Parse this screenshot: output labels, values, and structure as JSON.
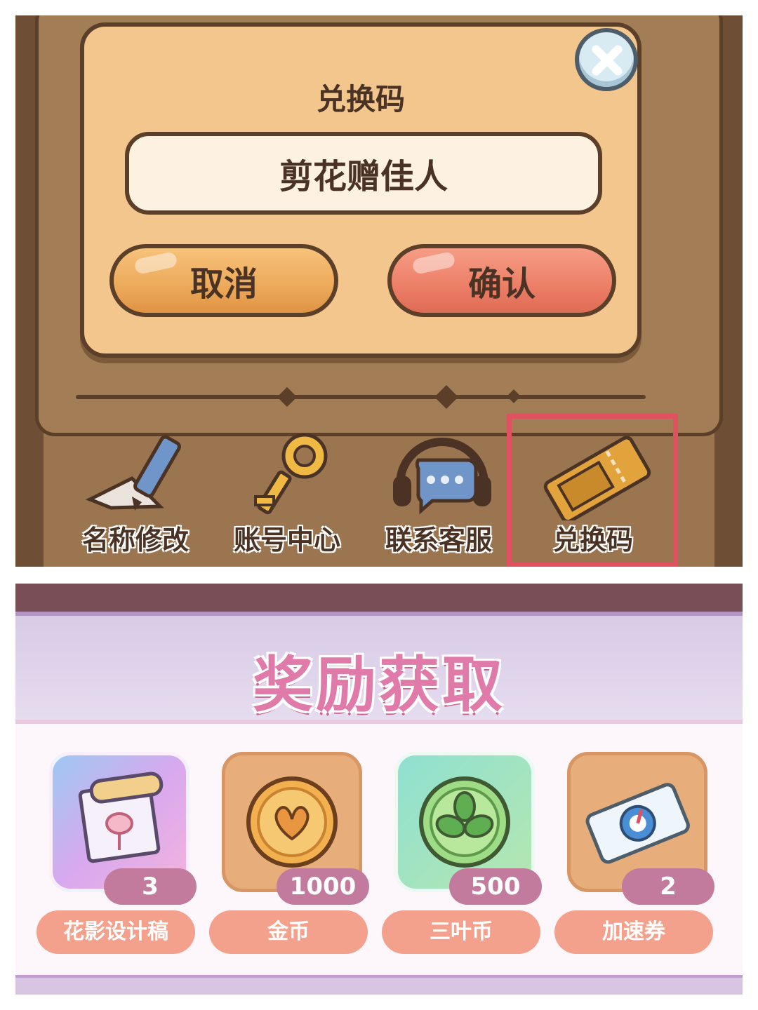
{
  "redeem_dialog": {
    "title": "兑换码",
    "code_value": "剪花赠佳人",
    "cancel_label": "取消",
    "confirm_label": "确认"
  },
  "menu": {
    "items": [
      {
        "label": "名称修改",
        "icon": "pencil-icon"
      },
      {
        "label": "账号中心",
        "icon": "key-icon"
      },
      {
        "label": "联系客服",
        "icon": "headset-icon"
      },
      {
        "label": "兑换码",
        "icon": "ticket-icon"
      }
    ],
    "highlighted": "兑换码"
  },
  "rewards": {
    "title": "奖励获取",
    "items": [
      {
        "name": "花影设计稿",
        "count": "3",
        "icon": "design-scroll-icon"
      },
      {
        "name": "金币",
        "count": "1000",
        "icon": "gold-coin-icon"
      },
      {
        "name": "三叶币",
        "count": "500",
        "icon": "clover-coin-icon"
      },
      {
        "name": "加速券",
        "count": "2",
        "icon": "speed-ticket-icon"
      }
    ]
  },
  "colors": {
    "highlight_border": "#e0525f",
    "confirm_button": "#ec7e66",
    "cancel_button": "#eca95a",
    "reward_title": "#e07aa8"
  }
}
